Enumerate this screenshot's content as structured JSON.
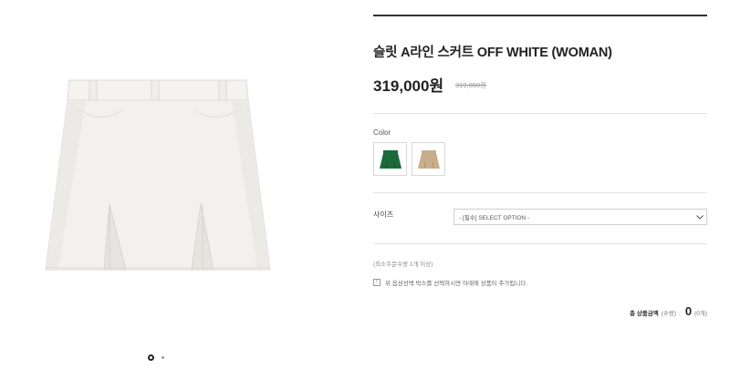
{
  "product": {
    "title": "슬릿 A라인 스커트 OFF WHITE (WOMAN)",
    "price": "319,000원",
    "original_price": "319,000원",
    "image_alt": "off-white skirt"
  },
  "options": {
    "color_label": "Color",
    "swatches": [
      {
        "name": "green",
        "color": "#1b6b3a"
      },
      {
        "name": "beige",
        "color": "#c9ad8b"
      }
    ],
    "size_label": "사이즈",
    "size_select_placeholder": "- [필수] SELECT OPTION -"
  },
  "order": {
    "min_order": "(최소주문수량 1개 이상)",
    "notice_icon": "!",
    "notice": "위 옵션선택 박스를 선택하시면 아래에 상품이 추가됩니다.",
    "total_label": "총 상품금액",
    "qty_label": "(수량)",
    "separator": ":",
    "total_value": "0",
    "count_text": "(0개)"
  },
  "gallery": {
    "slide_count": 2,
    "active_slide": 1
  },
  "colors": {
    "skirt": "#f2f1ee",
    "green": "#1b6b3a",
    "beige": "#c9ad8b"
  }
}
